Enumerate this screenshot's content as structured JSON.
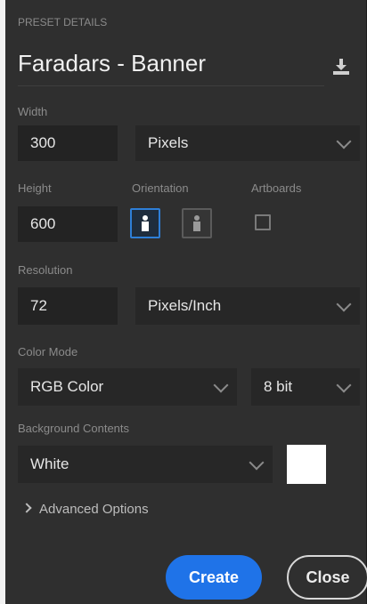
{
  "header": {
    "section_label": "PRESET DETAILS",
    "preset_name": "Faradars - Banner",
    "save_icon": "save-preset-icon"
  },
  "width": {
    "label": "Width",
    "value": "300",
    "unit": "Pixels"
  },
  "height": {
    "label": "Height",
    "value": "600"
  },
  "orientation": {
    "label": "Orientation",
    "selected": "portrait"
  },
  "artboards": {
    "label": "Artboards",
    "checked": false
  },
  "resolution": {
    "label": "Resolution",
    "value": "72",
    "unit": "Pixels/Inch"
  },
  "color_mode": {
    "label": "Color Mode",
    "mode": "RGB Color",
    "bit_depth": "8 bit"
  },
  "background": {
    "label": "Background Contents",
    "value": "White",
    "swatch_color": "#ffffff"
  },
  "advanced": {
    "label": "Advanced Options"
  },
  "actions": {
    "create_label": "Create",
    "close_label": "Close"
  },
  "colors": {
    "panel_bg": "#2f2f2f",
    "accent": "#1f73e8"
  }
}
